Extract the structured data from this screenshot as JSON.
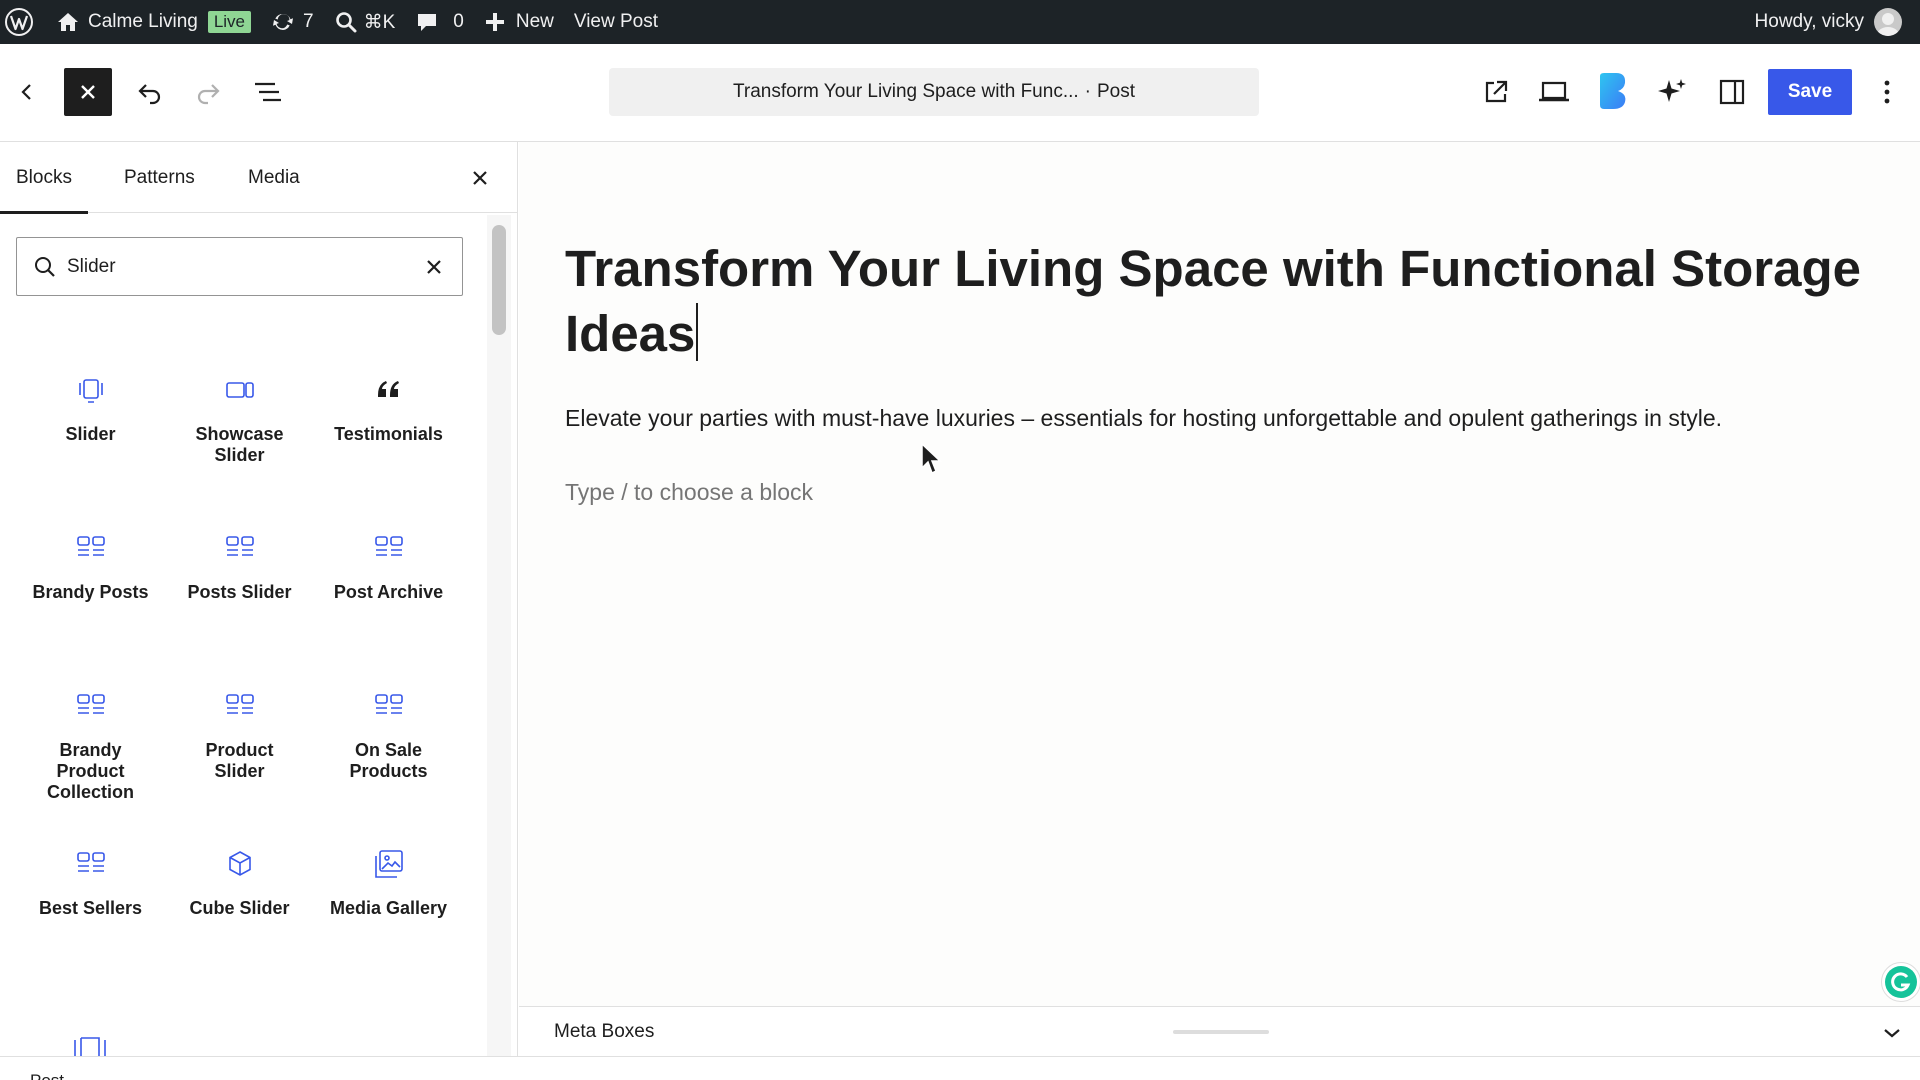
{
  "admin_bar": {
    "site_name": "Calme Living",
    "live_badge": "Live",
    "updates_count": "7",
    "search_shortcut": "⌘K",
    "comments_count": "0",
    "new_label": "New",
    "view_post_label": "View Post",
    "greeting": "Howdy, vicky"
  },
  "header": {
    "doc_title": "Transform Your Living Space with Func...",
    "doc_separator": "·",
    "doc_type": "Post",
    "save_label": "Save"
  },
  "inserter": {
    "tabs": [
      {
        "label": "Blocks",
        "active": true
      },
      {
        "label": "Patterns",
        "active": false
      },
      {
        "label": "Media",
        "active": false
      }
    ],
    "search": {
      "value": "Slider",
      "placeholder": "Search"
    },
    "blocks": [
      {
        "label": "Slider",
        "icon": "slider-icon"
      },
      {
        "label": "Showcase Slider",
        "icon": "showcase-slider-icon"
      },
      {
        "label": "Testimonials",
        "icon": "quote-icon"
      },
      {
        "label": "Brandy Posts",
        "icon": "posts-grid-icon"
      },
      {
        "label": "Posts Slider",
        "icon": "posts-grid-icon"
      },
      {
        "label": "Post Archive",
        "icon": "posts-grid-icon"
      },
      {
        "label": "Brandy Product Collection",
        "icon": "posts-grid-icon"
      },
      {
        "label": "Product Slider",
        "icon": "posts-grid-icon"
      },
      {
        "label": "On Sale Products",
        "icon": "posts-grid-icon"
      },
      {
        "label": "Best Sellers",
        "icon": "posts-grid-icon"
      },
      {
        "label": "Cube Slider",
        "icon": "cube-icon"
      },
      {
        "label": "Media Gallery",
        "icon": "gallery-icon"
      }
    ]
  },
  "post": {
    "title": "Transform Your Living Space with Functional Storage Ideas",
    "paragraph": "Elevate your parties with must-have luxuries – essentials for hosting unforgettable and opulent gatherings in style.",
    "block_placeholder": "Type / to choose a block"
  },
  "meta_boxes": {
    "label": "Meta Boxes"
  },
  "footer": {
    "breadcrumb": "Post"
  },
  "colors": {
    "accent": "#3858e9",
    "admin_bar": "#1d2327",
    "live_badge": "#8fd694"
  }
}
